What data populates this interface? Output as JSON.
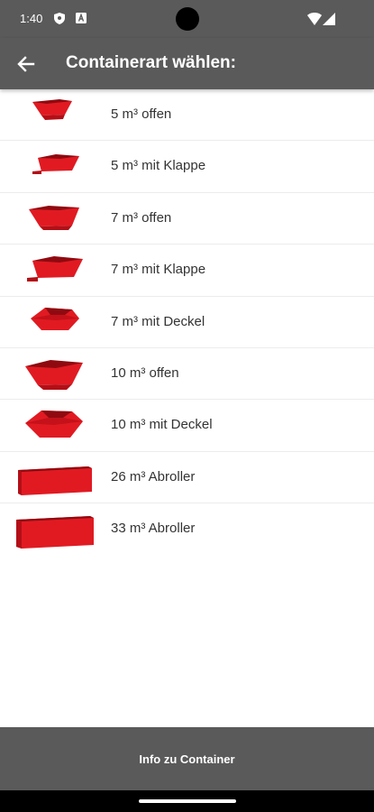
{
  "status_bar": {
    "time": "1:40",
    "icons": [
      "shield-icon",
      "a-badge-icon",
      "wifi-icon",
      "signal-icon"
    ]
  },
  "app_bar": {
    "back_icon": "arrow-left-icon",
    "title": "Containerart wählen:"
  },
  "accent_color": "#d9141c",
  "bar_color": "#5a5a5a",
  "containers": [
    {
      "label": "5 m³ offen",
      "icon": "container-open-icon"
    },
    {
      "label": "5 m³ mit Klappe",
      "icon": "container-flap-icon"
    },
    {
      "label": "7 m³ offen",
      "icon": "container-open-icon"
    },
    {
      "label": "7 m³ mit Klappe",
      "icon": "container-flap-icon"
    },
    {
      "label": "7 m³ mit Deckel",
      "icon": "container-lid-icon"
    },
    {
      "label": "10 m³ offen",
      "icon": "container-open-icon"
    },
    {
      "label": "10 m³ mit Deckel",
      "icon": "container-lid-icon"
    },
    {
      "label": "26 m³ Abroller",
      "icon": "container-roll-off-icon"
    },
    {
      "label": "33 m³ Abroller",
      "icon": "container-roll-off-icon"
    }
  ],
  "bottom_button": {
    "label": "Info zu Container"
  }
}
